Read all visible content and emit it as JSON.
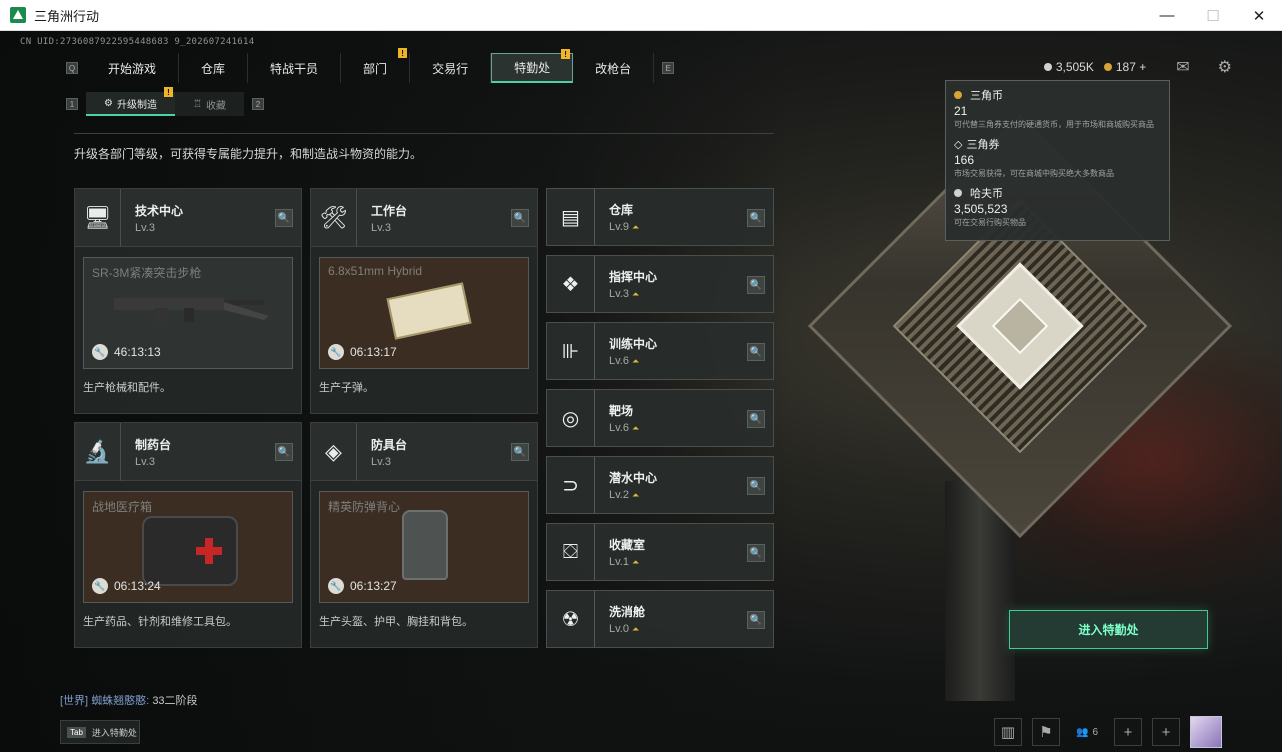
{
  "window": {
    "title": "三角洲行动",
    "minimize": "—",
    "maximize": "☐",
    "close": "✕"
  },
  "uid": "CN UID:2736087922595448683 9_202607241614",
  "nav": {
    "key_left": "Q",
    "key_right": "E",
    "tabs": [
      {
        "label": "开始游戏"
      },
      {
        "label": "仓库"
      },
      {
        "label": "特战干员"
      },
      {
        "label": "部门",
        "badge": "!"
      },
      {
        "label": "交易行"
      },
      {
        "label": "特勤处",
        "badge": "!",
        "active": true
      },
      {
        "label": "改枪台"
      }
    ]
  },
  "top_stats": {
    "coin1": "3,505K",
    "coin2": "187",
    "plus": "+",
    "coin1_color": "#cfd2cf",
    "coin2_color": "#d9a336"
  },
  "subnav": {
    "key_left": "1",
    "key_right": "2",
    "tabs": [
      {
        "label": "升级制造",
        "badge": "!",
        "active": true
      },
      {
        "label": "收藏"
      }
    ]
  },
  "description": "升级各部门等级，可获得专属能力提升，和制造战斗物资的能力。",
  "workstations": [
    {
      "name": "技术中心",
      "level": "Lv.3",
      "icon": "computer-icon",
      "product": "SR-3M紧凑突击步枪",
      "time": "46:13:13",
      "footer": "生产枪械和配件。"
    },
    {
      "name": "工作台",
      "level": "Lv.3",
      "icon": "tools-icon",
      "product": "6.8x51mm Hybrid",
      "time": "06:13:17",
      "footer": "生产子弹。"
    },
    {
      "name": "制药台",
      "level": "Lv.3",
      "icon": "microscope-icon",
      "product": "战地医疗箱",
      "time": "06:13:24",
      "footer": "生产药品、针剂和维修工具包。"
    },
    {
      "name": "防具台",
      "level": "Lv.3",
      "icon": "blocks-icon",
      "product": "精英防弹背心",
      "time": "06:13:27",
      "footer": "生产头盔、护甲、胸挂和背包。"
    }
  ],
  "facilities": [
    {
      "name": "仓库",
      "level": "Lv.9",
      "icon": "garage-icon"
    },
    {
      "name": "指挥中心",
      "level": "Lv.3",
      "icon": "chip-icon"
    },
    {
      "name": "训练中心",
      "level": "Lv.6",
      "icon": "dumbbell-icon"
    },
    {
      "name": "靶场",
      "level": "Lv.6",
      "icon": "target-icon"
    },
    {
      "name": "潜水中心",
      "level": "Lv.2",
      "icon": "goggles-icon"
    },
    {
      "name": "收藏室",
      "level": "Lv.1",
      "icon": "vault-icon"
    },
    {
      "name": "洗消舱",
      "level": "Lv.0",
      "icon": "hazard-icon"
    }
  ],
  "tooltip": {
    "items": [
      {
        "name": "三角币",
        "value": "21",
        "desc": "可代替三角券支付的硬通货币，用于市场和商城购买商品"
      },
      {
        "name": "三角券",
        "value": "166",
        "desc": "市场交易获得，可在商城中购买绝大多数商品"
      },
      {
        "name": "哈夫币",
        "value": "3,505,523",
        "desc": "可在交易行购买物品"
      }
    ]
  },
  "enter_button": "进入特勤处",
  "chat": {
    "channel": "[世界]",
    "user": "蜘蛛翘憨憨:",
    "message": "33二阶段"
  },
  "tab_hint": {
    "key": "Tab",
    "label": "进入特勤处"
  },
  "bottom": {
    "friends_count": "6"
  }
}
